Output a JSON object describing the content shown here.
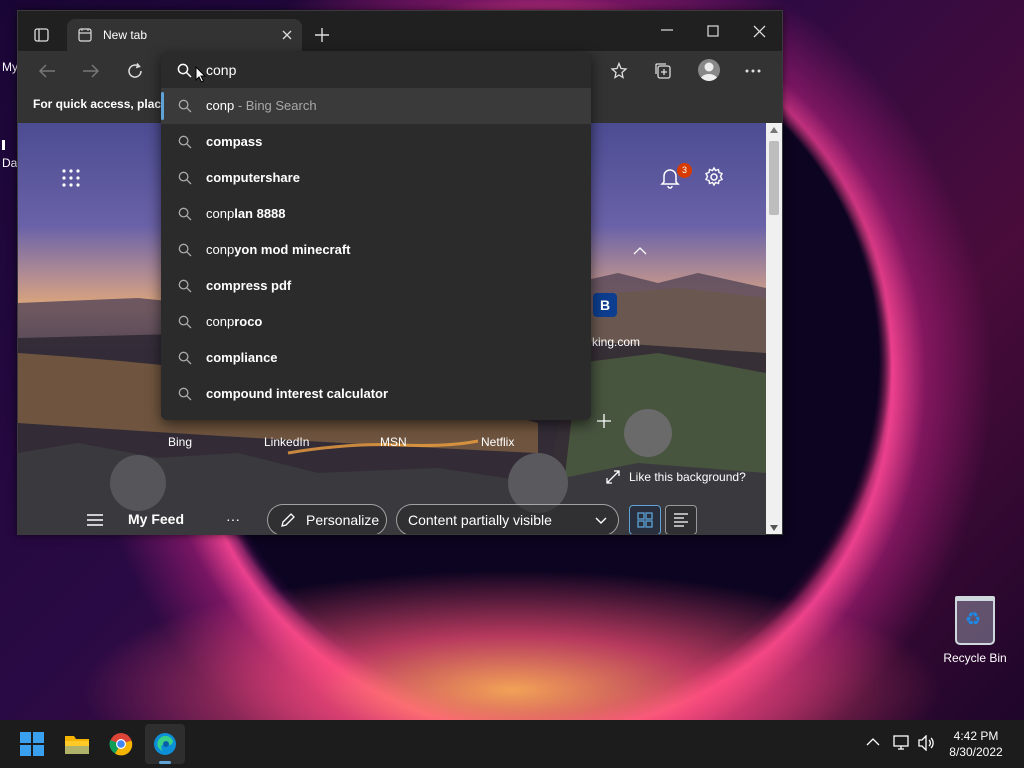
{
  "desktop": {
    "cutoff_labels": [
      "My",
      "Da"
    ],
    "recycle_bin_label": "Recycle Bin"
  },
  "browser": {
    "tab_title": "New tab",
    "favorites_bar_text": "For quick access, place y",
    "address_bar_value": "conp",
    "suggestions": [
      {
        "typed": "conp",
        "rest": "",
        "suffix": " - Bing Search"
      },
      {
        "typed": "",
        "rest": "compass",
        "suffix": ""
      },
      {
        "typed": "",
        "rest": "computershare",
        "suffix": ""
      },
      {
        "typed": "conp",
        "rest": "lan 8888",
        "suffix": ""
      },
      {
        "typed": "conp",
        "rest": "yon mod minecraft",
        "suffix": ""
      },
      {
        "typed": "",
        "rest": "compress pdf",
        "suffix": ""
      },
      {
        "typed": "conp",
        "rest": "roco",
        "suffix": ""
      },
      {
        "typed": "",
        "rest": "compliance",
        "suffix": ""
      },
      {
        "typed": "",
        "rest": "compound interest calculator",
        "suffix": ""
      }
    ]
  },
  "newtab": {
    "notification_count": "3",
    "quick_links": [
      "Bing",
      "LinkedIn",
      "MSN",
      "Netflix"
    ],
    "partial_site_label": "king.com",
    "partial_site_initial": "B",
    "like_background": "Like this background?",
    "my_feed": "My Feed",
    "personalize": "Personalize",
    "content_visibility": "Content partially visible",
    "more": "···"
  },
  "taskbar": {
    "time": "4:42 PM",
    "date": "8/30/2022"
  },
  "colors": {
    "accent": "#5ea2d6",
    "notification_badge": "#d83b01",
    "booking_blue": "#0d3d8e"
  }
}
